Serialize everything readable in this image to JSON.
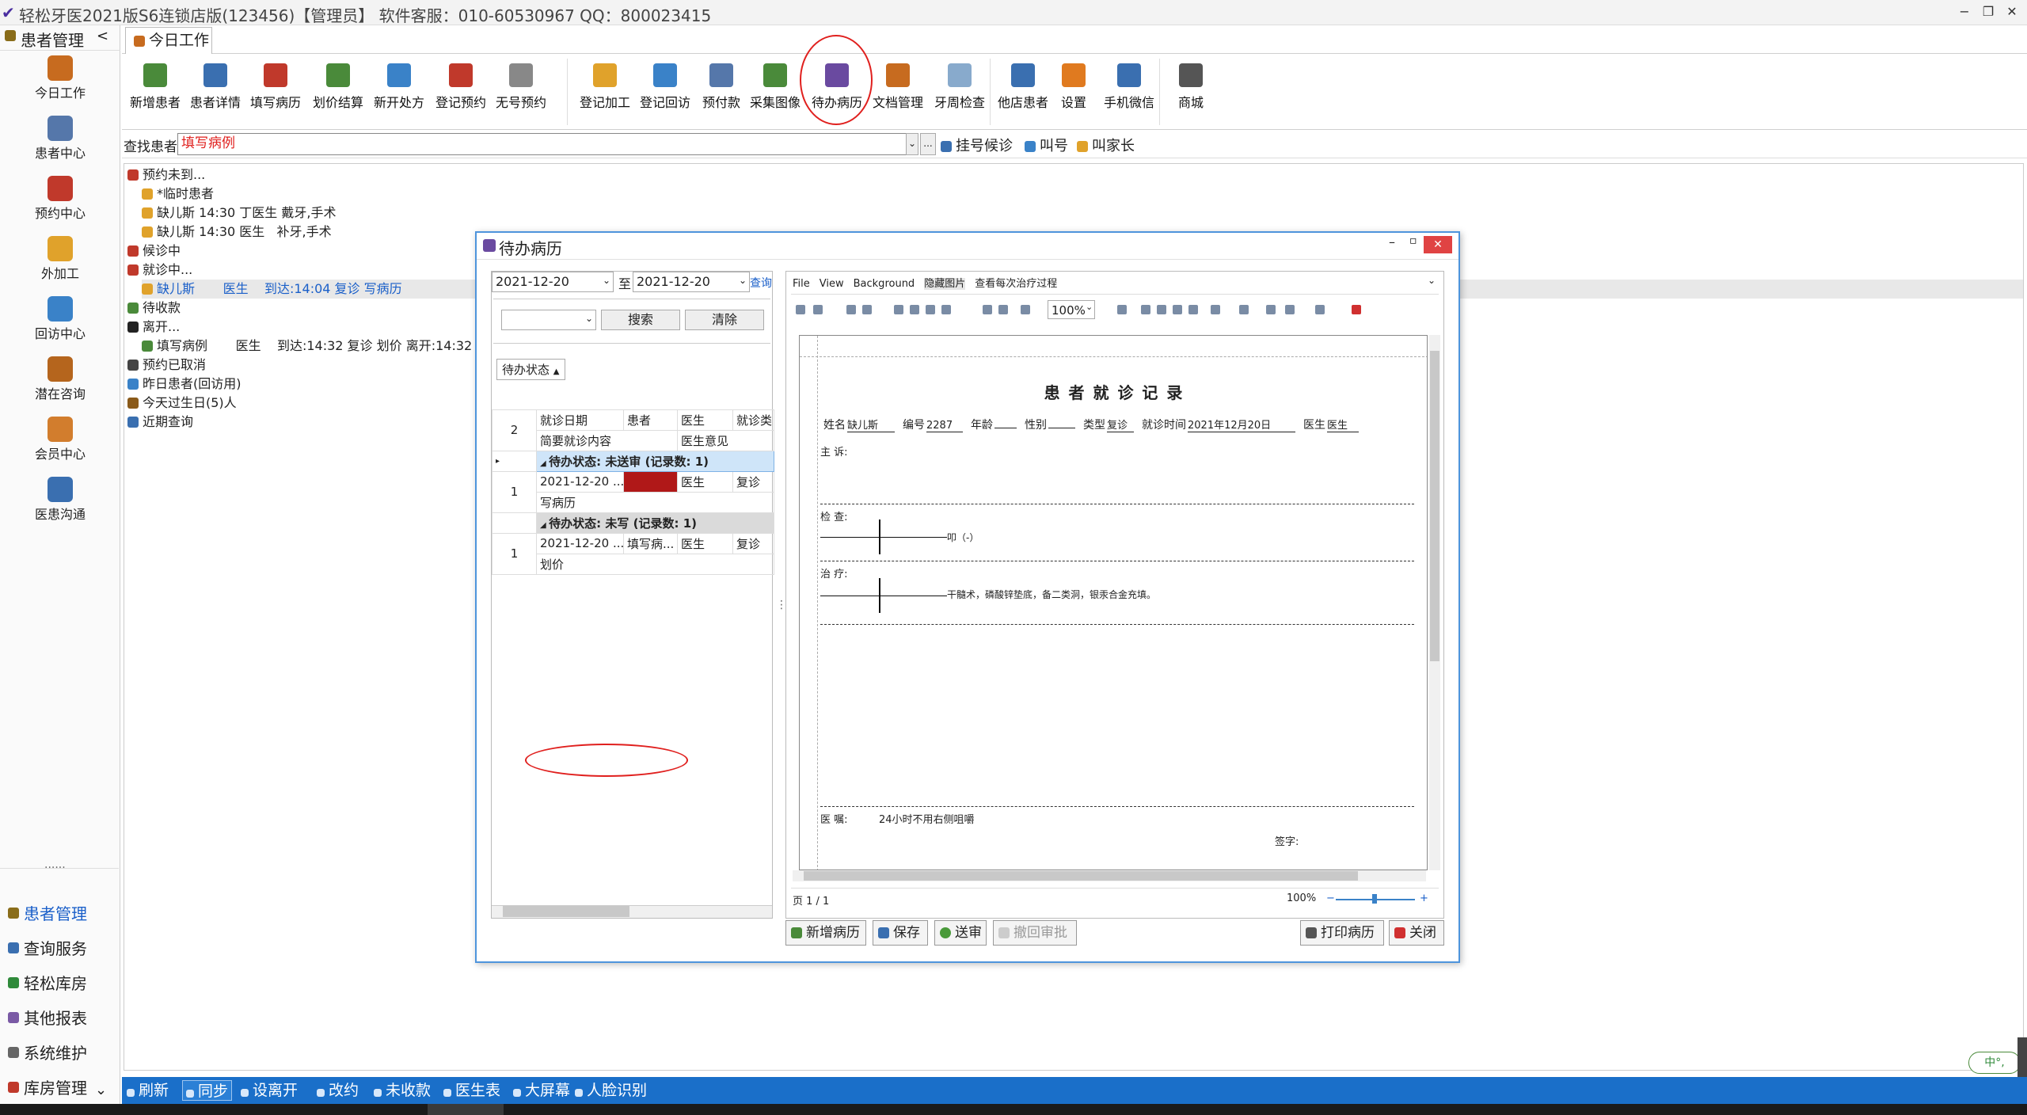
{
  "app": {
    "title": "轻松牙医2021版S6连锁店版(123456)【管理员】   软件客服：010-60530967 QQ：800023415"
  },
  "left_nav": {
    "header": "患者管理",
    "collapse": "<",
    "items": [
      {
        "label": "今日工作",
        "icon": "today-work-icon",
        "color": "#c76b1f"
      },
      {
        "label": "患者中心",
        "icon": "patients-icon",
        "color": "#5577aa"
      },
      {
        "label": "预约中心",
        "icon": "calendar-icon",
        "color": "#c0392b"
      },
      {
        "label": "外加工",
        "icon": "cubes-icon",
        "color": "#e0a22b"
      },
      {
        "label": "回访中心",
        "icon": "refresh-icon",
        "color": "#3a82c8"
      },
      {
        "label": "潜在咨询",
        "icon": "consult-icon",
        "color": "#b5651d"
      },
      {
        "label": "会员中心",
        "icon": "members-icon",
        "color": "#d27d2d"
      },
      {
        "label": "医患沟通",
        "icon": "video-icon",
        "color": "#3a6fb0"
      }
    ],
    "dots": "......",
    "modules": [
      {
        "label": "患者管理",
        "active": true,
        "color": "#8a6d1a"
      },
      {
        "label": "查询服务",
        "active": false,
        "color": "#3a6fb0"
      },
      {
        "label": "轻松库房",
        "active": false,
        "color": "#2f8a3a"
      },
      {
        "label": "其他报表",
        "active": false,
        "color": "#7a5aa5"
      },
      {
        "label": "系统维护",
        "active": false,
        "color": "#666666"
      },
      {
        "label": "库房管理",
        "active": false,
        "color": "#c0392b"
      }
    ],
    "bottom_chevron": "⌄"
  },
  "tab": {
    "label": "今日工作"
  },
  "ribbon": [
    {
      "label": "新增患者",
      "icon": "add-patient-icon",
      "color": "#4a8a3a"
    },
    {
      "label": "患者详情",
      "icon": "patient-detail-icon",
      "color": "#3a6fb0"
    },
    {
      "label": "填写病历",
      "icon": "write-record-icon",
      "color": "#c0392b"
    },
    {
      "label": "划价结算",
      "icon": "yuan-icon",
      "color": "#4a8a3a"
    },
    {
      "label": "新开处方",
      "icon": "capsule-icon",
      "color": "#3a82c8"
    },
    {
      "label": "登记预约",
      "icon": "appointment-icon",
      "color": "#c0392b"
    },
    {
      "label": "无号预约",
      "icon": "no-number-appointment-icon",
      "color": "#888888"
    },
    {
      "label": "登记加工",
      "icon": "processing-icon",
      "color": "#e0a22b"
    },
    {
      "label": "登记回访",
      "icon": "followup-icon",
      "color": "#3a82c8"
    },
    {
      "label": "预付款",
      "icon": "prepay-icon",
      "color": "#5577aa"
    },
    {
      "label": "采集图像",
      "icon": "image-icon",
      "color": "#4a8a3a"
    },
    {
      "label": "待办病历",
      "icon": "todo-record-icon",
      "color": "#6a4aa0"
    },
    {
      "label": "文档管理",
      "icon": "document-icon",
      "color": "#c76b1f"
    },
    {
      "label": "牙周检查",
      "icon": "tooth-icon",
      "color": "#88aacc"
    },
    {
      "label": "他店患者",
      "icon": "other-store-icon",
      "color": "#3a6fb0"
    },
    {
      "label": "设置",
      "icon": "settings-icon",
      "color": "#e07a1f"
    },
    {
      "label": "手机微信",
      "icon": "phone-icon",
      "color": "#3a6fb0"
    },
    {
      "label": "商城",
      "icon": "cart-icon",
      "color": "#555555"
    }
  ],
  "search": {
    "label": "查找患者",
    "value": "填写病例",
    "dropdown": "⌄",
    "more": "...",
    "links": [
      "挂号候诊",
      "叫号",
      "叫家长"
    ]
  },
  "tree": [
    {
      "text": "预约未到...",
      "indent": 0,
      "color": "#c0392b"
    },
    {
      "text": "*临时患者",
      "indent": 1,
      "color": "#e0a22b"
    },
    {
      "text": "缺儿斯 14:30 丁医生 戴牙,手术",
      "indent": 1,
      "color": "#e0a22b"
    },
    {
      "text": "缺儿斯 14:30 医生   补牙,手术",
      "indent": 1,
      "color": "#e0a22b"
    },
    {
      "text": "候诊中",
      "indent": 0,
      "color": "#c0392b"
    },
    {
      "text": "就诊中...",
      "indent": 0,
      "color": "#c0392b"
    },
    {
      "text": "缺儿斯       医生    到达:14:04 复诊 写病历",
      "indent": 1,
      "color": "#e0a22b",
      "selected": true
    },
    {
      "text": "待收款",
      "indent": 0,
      "color": "#4a8a3a"
    },
    {
      "text": "离开...",
      "indent": 0,
      "color": "#222222"
    },
    {
      "text": "填写病例       医生    到达:14:32 复诊 划价 离开:14:32",
      "indent": 1,
      "color": "#4a8a3a"
    },
    {
      "text": "预约已取消",
      "indent": 0,
      "color": "#444444"
    },
    {
      "text": "昨日患者(回访用)",
      "indent": 0,
      "color": "#3a82c8"
    },
    {
      "text": "今天过生日(5)人",
      "indent": 0,
      "color": "#8a5a1a"
    },
    {
      "text": "近期查询",
      "indent": 0,
      "color": "#3a6fb0"
    }
  ],
  "status_bar": [
    "刷新",
    "同步",
    "设离开",
    "改约",
    "未收款",
    "医生表",
    "大屏幕",
    "人脸识别"
  ],
  "tray_badge": "中°,",
  "dialog": {
    "title": "待办病历",
    "date_from": "2021-12-20",
    "to_label": "至",
    "date_to": "2021-12-20",
    "query": "查询",
    "search_btn": "搜索",
    "clear_btn": "清除",
    "group_field": "待办状态",
    "sort_arrow": "▲",
    "columns": [
      "就诊日期",
      "患者",
      "医生",
      "就诊类"
    ],
    "subcolumns": [
      "简要就诊内容",
      "医生意见"
    ],
    "row_indicator": "2",
    "groups": [
      {
        "label": "待办状态: 未送审 (记录数: 1)",
        "rownum": "1",
        "date": "2021-12-20 ...",
        "patient": "",
        "doctor": "医生",
        "type": "复诊",
        "content": "写病历"
      },
      {
        "label": "待办状态: 未写 (记录数: 1)",
        "rownum": "1",
        "date": "2021-12-20 ...",
        "patient": "填写病...",
        "doctor": "医生",
        "type": "复诊",
        "content": "划价"
      }
    ],
    "viewer": {
      "menu": [
        "File",
        "View",
        "Background",
        "隐藏图片",
        "查看每次治疗过程"
      ],
      "zoom": "100%",
      "doc_title": "患 者 就 诊 记 录",
      "fields": [
        {
          "label": "姓名",
          "value": "缺儿斯"
        },
        {
          "label": "编号",
          "value": "2287"
        },
        {
          "label": "年龄",
          "value": ""
        },
        {
          "label": "性别",
          "value": ""
        },
        {
          "label": "类型",
          "value": "复诊"
        },
        {
          "label": "就诊时间",
          "value": "2021年12月20日"
        },
        {
          "label": "医生",
          "value": "医生"
        }
      ],
      "complaint_label": "主   诉:",
      "exam_label": "检   查:",
      "exam_text": "叩（-）",
      "treat_label": "治   疗:",
      "treat_text": "干髓术，磷酸锌垫底，备二类洞，银汞合金充填。",
      "advice_label": "医   嘱:",
      "advice_text": "24小时不用右侧咀嚼",
      "sign_label": "签字:",
      "page": "页 1 / 1",
      "status_zoom": "100%"
    },
    "buttons": {
      "new_record": "新增病历",
      "save": "保存",
      "submit": "送审",
      "revoke": "撤回审批",
      "print": "打印病历",
      "close": "关闭"
    }
  }
}
